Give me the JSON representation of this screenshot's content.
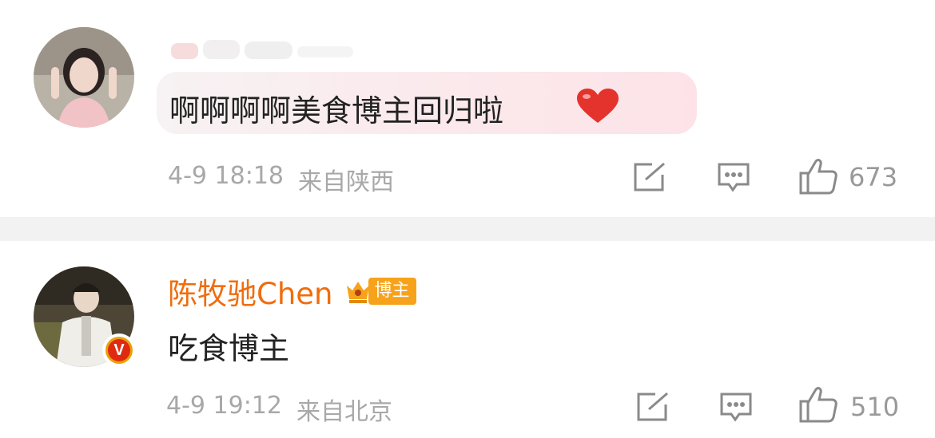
{
  "comments": [
    {
      "username": "",
      "text": "啊啊啊啊美食博主回归啦",
      "date": "4-9 18:18",
      "location": "来自陕西",
      "likes": "673"
    },
    {
      "username": "陈牧驰Chen",
      "badge": "博主",
      "text": "吃食博主",
      "date": "4-9 19:12",
      "location": "来自北京",
      "likes": "510"
    }
  ],
  "colors": {
    "username": "#f06d0e",
    "badge": "#f7a21b",
    "meta": "#a8a8a8",
    "heart": "#e4332d"
  },
  "icons": [
    "share-icon",
    "reply-icon",
    "like-icon",
    "heart-emoji",
    "crown-icon",
    "verified-v-icon"
  ]
}
